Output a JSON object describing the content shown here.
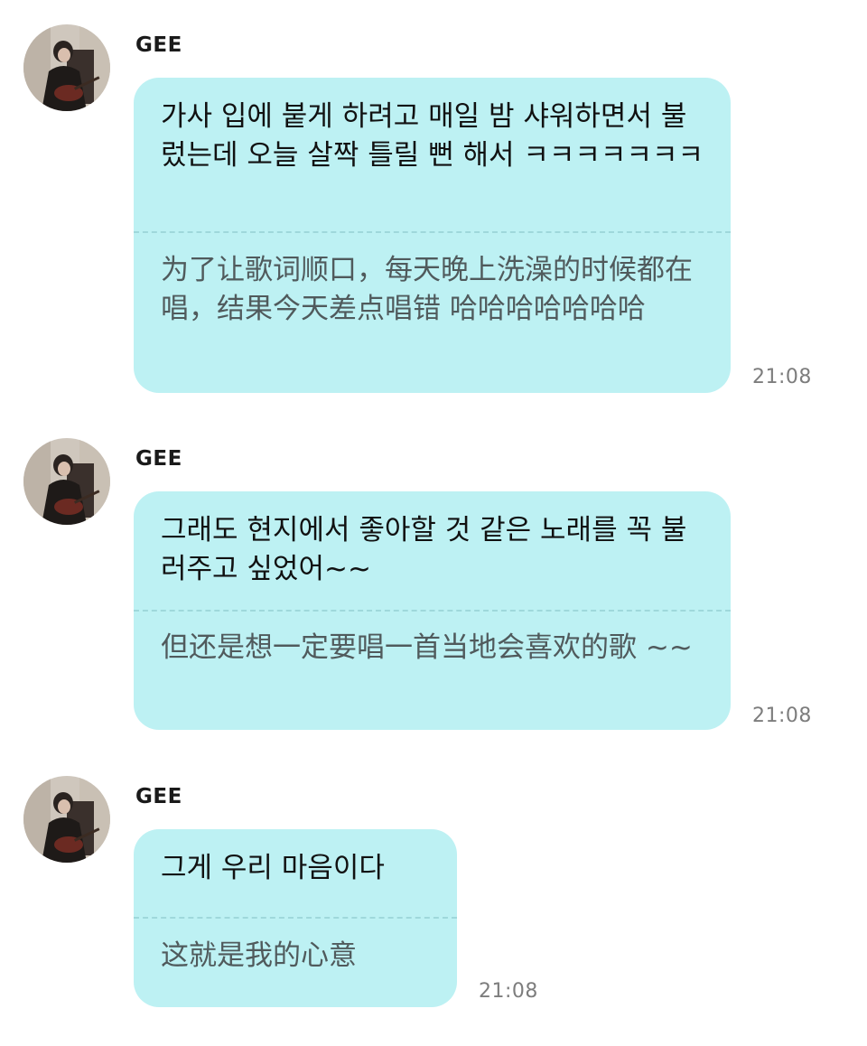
{
  "messages": [
    {
      "sender": "GEE",
      "text_ko": "가사 입에 붙게 하려고 매일 밤 샤워하면서 불렀는데 오늘 살짝 틀릴 뻔 해서 ㅋㅋㅋㅋㅋㅋㅋ",
      "text_zh": "为了让歌词顺口，每天晚上洗澡的时候都在唱，结果今天差点唱错 哈哈哈哈哈哈哈",
      "time": "21:08"
    },
    {
      "sender": "GEE",
      "text_ko": "그래도 현지에서 좋아할 것 같은 노래를 꼭 불러주고 싶었어~~",
      "text_zh": "但还是想一定要唱一首当地会喜欢的歌 ~~",
      "time": "21:08"
    },
    {
      "sender": "GEE",
      "text_ko": "그게 우리 마음이다",
      "text_zh": "这就是我的心意",
      "time": "21:08"
    }
  ],
  "colors": {
    "bubble": "#bdf1f3",
    "divider": "#9fd8db",
    "time": "#7d7d7d"
  },
  "icons": {
    "avatar": "profile-photo-person-with-guitar"
  }
}
